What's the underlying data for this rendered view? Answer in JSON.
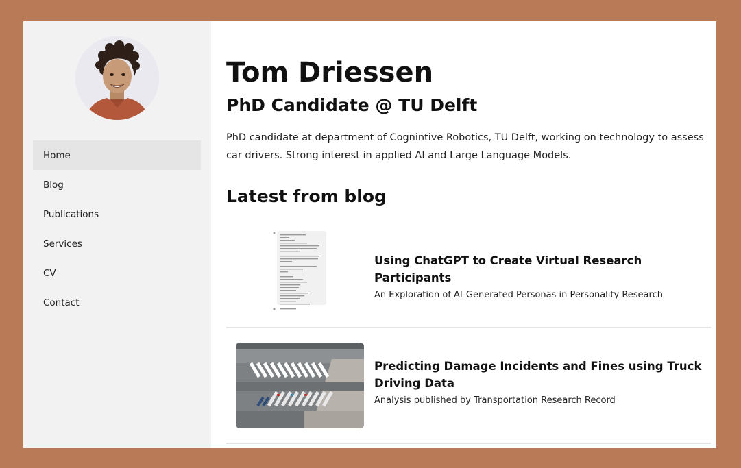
{
  "sidebar": {
    "nav": [
      "Home",
      "Blog",
      "Publications",
      "Services",
      "CV",
      "Contact"
    ]
  },
  "profile": {
    "name": "Tom Driessen",
    "role": "PhD Candidate @ TU Delft",
    "bio": "PhD candidate at department of Cognintive Robotics, TU Delft, working on technology to assess car drivers. Strong interest in applied AI and Large Language Models."
  },
  "blog": {
    "heading": "Latest from blog",
    "posts": [
      {
        "title": "Using ChatGPT to Create Virtual Research Participants",
        "subtitle": "An Exploration of AI-Generated Personas in Personality Research"
      },
      {
        "title": "Predicting Damage Incidents and Fines using Truck Driving Data",
        "subtitle": "Analysis published by Transportation Research Record"
      }
    ]
  },
  "colors": {
    "border": "#b97a58",
    "sidebar": "#f2f2f3",
    "active_nav": "#e5e5e6"
  }
}
